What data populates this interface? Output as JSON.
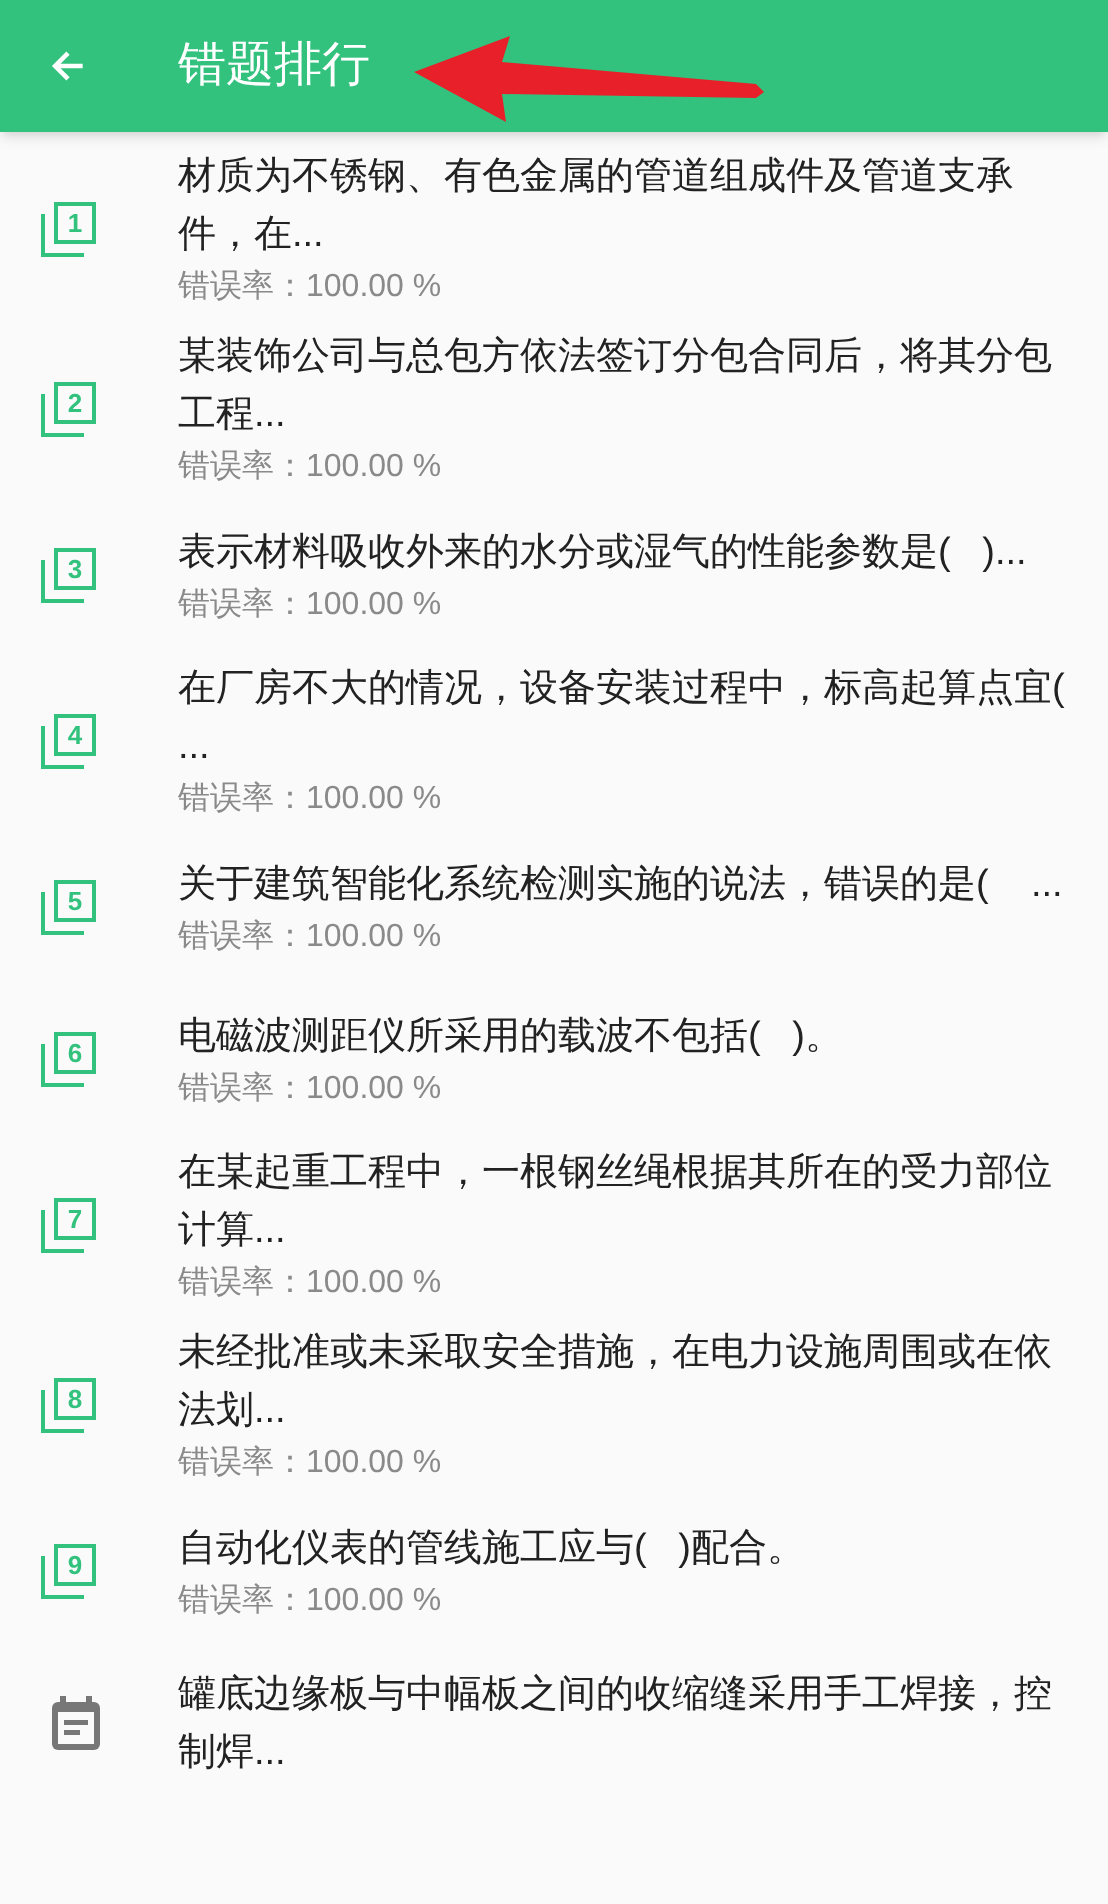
{
  "header": {
    "title": "错题排行",
    "annotation": {
      "kind": "arrow",
      "color": "#e8202a"
    }
  },
  "items": [
    {
      "kind": "rank",
      "rank": "1",
      "title": "材质为不锈钢、有色金属的管道组成件及管道支承件，在...",
      "rate": "错误率：100.00 %"
    },
    {
      "kind": "rank",
      "rank": "2",
      "title": "某装饰公司与总包方依法签订分包合同后，将其分包工程...",
      "rate": "错误率：100.00 %"
    },
    {
      "kind": "rank",
      "rank": "3",
      "title": "表示材料吸收外来的水分或湿气的性能参数是(   )...",
      "rate": "错误率：100.00 %"
    },
    {
      "kind": "rank",
      "rank": "4",
      "title": "在厂房不大的情况，设备安装过程中，标高起算点宜( ...",
      "rate": "错误率：100.00 %"
    },
    {
      "kind": "rank",
      "rank": "5",
      "title": "关于建筑智能化系统检测实施的说法，错误的是(    ...",
      "rate": "错误率：100.00 %"
    },
    {
      "kind": "rank",
      "rank": "6",
      "title": "电磁波测距仪所采用的载波不包括(   )。",
      "rate": "错误率：100.00 %"
    },
    {
      "kind": "rank",
      "rank": "7",
      "title": "在某起重工程中，一根钢丝绳根据其所在的受力部位计算...",
      "rate": "错误率：100.00 %"
    },
    {
      "kind": "rank",
      "rank": "8",
      "title": "未经批准或未采取安全措施，在电力设施周围或在依法划...",
      "rate": "错误率：100.00 %"
    },
    {
      "kind": "rank",
      "rank": "9",
      "title": "自动化仪表的管线施工应与(   )配合。",
      "rate": "错误率：100.00 %"
    },
    {
      "kind": "note",
      "title": "罐底边缘板与中幅板之间的收缩缝采用手工焊接，控制焊..."
    }
  ]
}
